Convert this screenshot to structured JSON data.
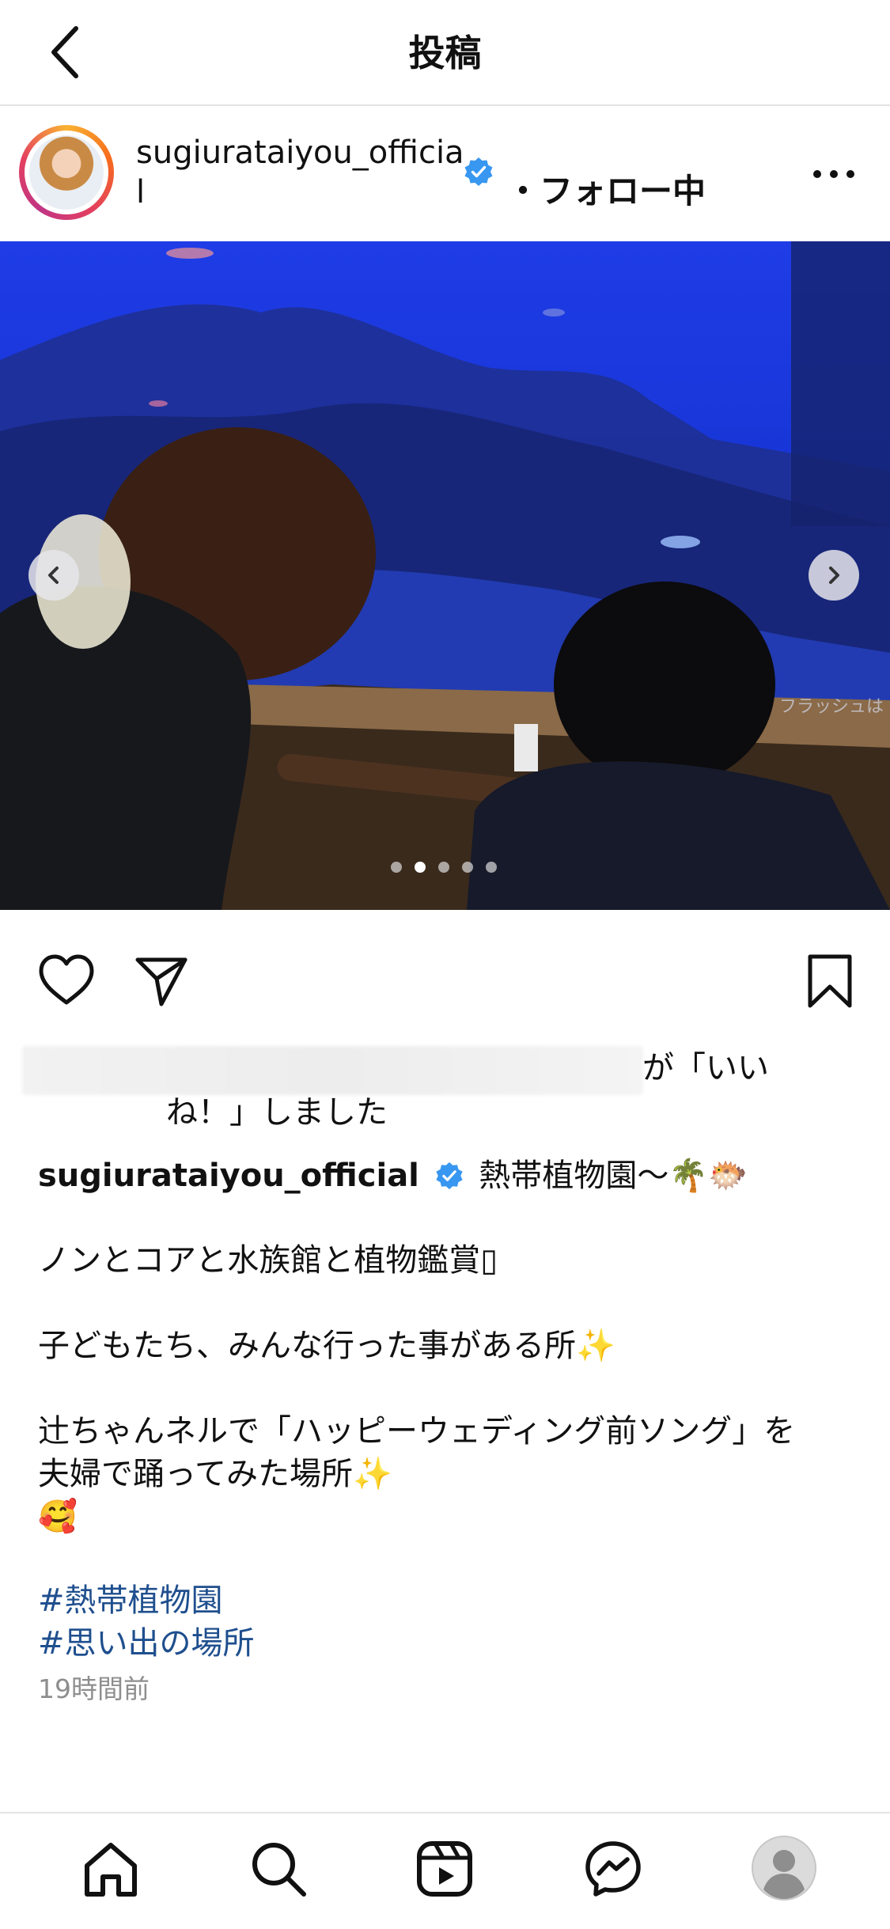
{
  "header": {
    "title": "投稿"
  },
  "post": {
    "username": "sugiurataiyou_official",
    "follow_status": "・フォロー中"
  },
  "carousel": {
    "slide_count": 5,
    "active_index": 1,
    "watermark_text": "フラッシュは"
  },
  "likes": {
    "suffix": "が「いい",
    "line2": "ね！」しました"
  },
  "caption": {
    "username": "sugiurataiyou_official",
    "line1": "熱帯植物園〜🌴🐡",
    "line2": "ノンとコアと水族館と植物鑑賞▯",
    "line3": "子どもたち、みんな行った事がある所✨",
    "line4": "辻ちゃんネルで「ハッピーウェディング前ソング」を",
    "line5": "夫婦で踊ってみた場所✨",
    "line6": "🥰",
    "hashtags": [
      "#熱帯植物園",
      "#思い出の場所"
    ]
  },
  "time_ago": "19時間前",
  "colors": {
    "verified": "#3897f0",
    "hashtag": "#1f4f8e",
    "meta_gray": "#8e8e8e"
  }
}
